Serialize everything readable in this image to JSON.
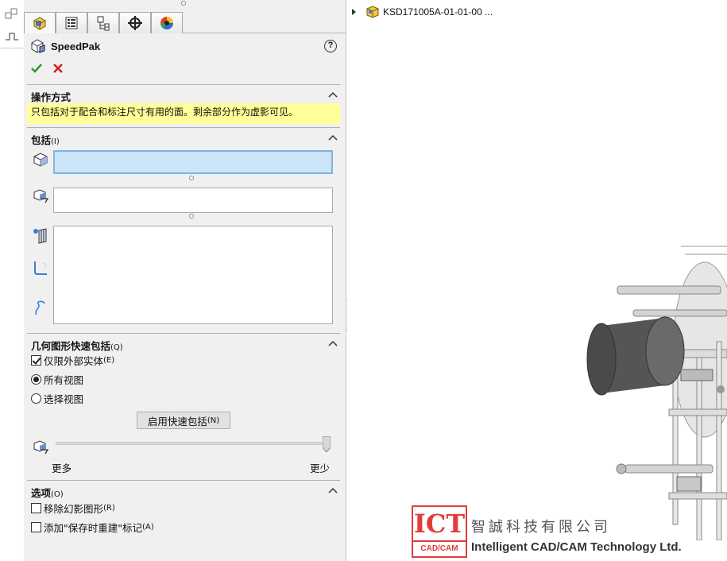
{
  "feature_manager": {
    "tabs": [
      {
        "name": "featuremanager-tab-icon",
        "active": true
      },
      {
        "name": "propertymanager-tab-icon",
        "active": false
      },
      {
        "name": "configurationmanager-tab-icon",
        "active": false
      },
      {
        "name": "dimxpert-tab-icon",
        "active": false
      },
      {
        "name": "display-manager-tab-icon",
        "active": false
      }
    ]
  },
  "property_manager": {
    "title": "SpeedPak",
    "help_label": "?",
    "message_group": {
      "title": "操作方式",
      "message": "只包括对于配合和标注尺寸有用的面。剩余部分作为虚影可见。"
    },
    "include_group": {
      "title": "包括",
      "shortcut": "(I)"
    },
    "quick_include_group": {
      "title": "几何图形快速包括",
      "shortcut": "(Q)",
      "external_bodies_only": {
        "label": "仅限外部实体",
        "shortcut": "(E)",
        "checked": true
      },
      "all_views": {
        "label": "所有视图",
        "checked": true
      },
      "selected_views": {
        "label": "选择视图",
        "checked": false
      },
      "enable_button": {
        "label": "启用快速包括",
        "shortcut": "(N)"
      },
      "slider": {
        "min_label": "更多",
        "max_label": "更少",
        "value": 1.0
      }
    },
    "options_group": {
      "title": "选项",
      "shortcut": "(O)",
      "remove_ghost": {
        "label": "移除幻影图形",
        "shortcut": "(R)",
        "checked": false
      },
      "add_rebuild_mark": {
        "label": "添加\"保存时重建\"标记",
        "shortcut": "(A)",
        "checked": false
      }
    }
  },
  "graphics_area": {
    "tree_root": "KSD171005A-01-01-00 ..."
  },
  "watermark": {
    "logo_text": "ICT",
    "logo_sub": "CAD/CAM",
    "company_cn": "智誠科技有限公司",
    "company_en": "Intelligent CAD/CAM Technology Ltd."
  },
  "colors": {
    "accent_ok": "#2e9b2e",
    "accent_cancel": "#d22020",
    "message_bg": "#ffff99",
    "active_selection": "#cce4f7",
    "logo_red": "#e23b3b"
  }
}
